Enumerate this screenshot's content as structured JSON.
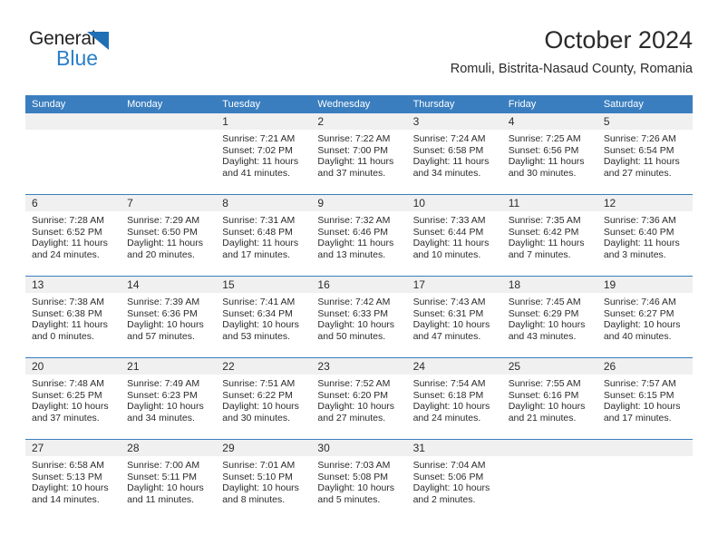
{
  "logo": {
    "word1": "General",
    "word2": "Blue",
    "triangle_color": "#1f6fb5",
    "word2_color": "#2a7fc9"
  },
  "header": {
    "title": "October 2024",
    "subtitle": "Romuli, Bistrita-Nasaud County, Romania"
  },
  "calendar": {
    "header_color": "#3a7ebf",
    "weekdays": [
      "Sunday",
      "Monday",
      "Tuesday",
      "Wednesday",
      "Thursday",
      "Friday",
      "Saturday"
    ],
    "weeks": [
      [
        {
          "day": "",
          "sunrise": "",
          "sunset": "",
          "daylight_line1": "",
          "daylight_line2": "",
          "empty": true
        },
        {
          "day": "",
          "sunrise": "",
          "sunset": "",
          "daylight_line1": "",
          "daylight_line2": "",
          "empty": true
        },
        {
          "day": "1",
          "sunrise": "Sunrise: 7:21 AM",
          "sunset": "Sunset: 7:02 PM",
          "daylight_line1": "Daylight: 11 hours",
          "daylight_line2": "and 41 minutes."
        },
        {
          "day": "2",
          "sunrise": "Sunrise: 7:22 AM",
          "sunset": "Sunset: 7:00 PM",
          "daylight_line1": "Daylight: 11 hours",
          "daylight_line2": "and 37 minutes."
        },
        {
          "day": "3",
          "sunrise": "Sunrise: 7:24 AM",
          "sunset": "Sunset: 6:58 PM",
          "daylight_line1": "Daylight: 11 hours",
          "daylight_line2": "and 34 minutes."
        },
        {
          "day": "4",
          "sunrise": "Sunrise: 7:25 AM",
          "sunset": "Sunset: 6:56 PM",
          "daylight_line1": "Daylight: 11 hours",
          "daylight_line2": "and 30 minutes."
        },
        {
          "day": "5",
          "sunrise": "Sunrise: 7:26 AM",
          "sunset": "Sunset: 6:54 PM",
          "daylight_line1": "Daylight: 11 hours",
          "daylight_line2": "and 27 minutes."
        }
      ],
      [
        {
          "day": "6",
          "sunrise": "Sunrise: 7:28 AM",
          "sunset": "Sunset: 6:52 PM",
          "daylight_line1": "Daylight: 11 hours",
          "daylight_line2": "and 24 minutes."
        },
        {
          "day": "7",
          "sunrise": "Sunrise: 7:29 AM",
          "sunset": "Sunset: 6:50 PM",
          "daylight_line1": "Daylight: 11 hours",
          "daylight_line2": "and 20 minutes."
        },
        {
          "day": "8",
          "sunrise": "Sunrise: 7:31 AM",
          "sunset": "Sunset: 6:48 PM",
          "daylight_line1": "Daylight: 11 hours",
          "daylight_line2": "and 17 minutes."
        },
        {
          "day": "9",
          "sunrise": "Sunrise: 7:32 AM",
          "sunset": "Sunset: 6:46 PM",
          "daylight_line1": "Daylight: 11 hours",
          "daylight_line2": "and 13 minutes."
        },
        {
          "day": "10",
          "sunrise": "Sunrise: 7:33 AM",
          "sunset": "Sunset: 6:44 PM",
          "daylight_line1": "Daylight: 11 hours",
          "daylight_line2": "and 10 minutes."
        },
        {
          "day": "11",
          "sunrise": "Sunrise: 7:35 AM",
          "sunset": "Sunset: 6:42 PM",
          "daylight_line1": "Daylight: 11 hours",
          "daylight_line2": "and 7 minutes."
        },
        {
          "day": "12",
          "sunrise": "Sunrise: 7:36 AM",
          "sunset": "Sunset: 6:40 PM",
          "daylight_line1": "Daylight: 11 hours",
          "daylight_line2": "and 3 minutes."
        }
      ],
      [
        {
          "day": "13",
          "sunrise": "Sunrise: 7:38 AM",
          "sunset": "Sunset: 6:38 PM",
          "daylight_line1": "Daylight: 11 hours",
          "daylight_line2": "and 0 minutes."
        },
        {
          "day": "14",
          "sunrise": "Sunrise: 7:39 AM",
          "sunset": "Sunset: 6:36 PM",
          "daylight_line1": "Daylight: 10 hours",
          "daylight_line2": "and 57 minutes."
        },
        {
          "day": "15",
          "sunrise": "Sunrise: 7:41 AM",
          "sunset": "Sunset: 6:34 PM",
          "daylight_line1": "Daylight: 10 hours",
          "daylight_line2": "and 53 minutes."
        },
        {
          "day": "16",
          "sunrise": "Sunrise: 7:42 AM",
          "sunset": "Sunset: 6:33 PM",
          "daylight_line1": "Daylight: 10 hours",
          "daylight_line2": "and 50 minutes."
        },
        {
          "day": "17",
          "sunrise": "Sunrise: 7:43 AM",
          "sunset": "Sunset: 6:31 PM",
          "daylight_line1": "Daylight: 10 hours",
          "daylight_line2": "and 47 minutes."
        },
        {
          "day": "18",
          "sunrise": "Sunrise: 7:45 AM",
          "sunset": "Sunset: 6:29 PM",
          "daylight_line1": "Daylight: 10 hours",
          "daylight_line2": "and 43 minutes."
        },
        {
          "day": "19",
          "sunrise": "Sunrise: 7:46 AM",
          "sunset": "Sunset: 6:27 PM",
          "daylight_line1": "Daylight: 10 hours",
          "daylight_line2": "and 40 minutes."
        }
      ],
      [
        {
          "day": "20",
          "sunrise": "Sunrise: 7:48 AM",
          "sunset": "Sunset: 6:25 PM",
          "daylight_line1": "Daylight: 10 hours",
          "daylight_line2": "and 37 minutes."
        },
        {
          "day": "21",
          "sunrise": "Sunrise: 7:49 AM",
          "sunset": "Sunset: 6:23 PM",
          "daylight_line1": "Daylight: 10 hours",
          "daylight_line2": "and 34 minutes."
        },
        {
          "day": "22",
          "sunrise": "Sunrise: 7:51 AM",
          "sunset": "Sunset: 6:22 PM",
          "daylight_line1": "Daylight: 10 hours",
          "daylight_line2": "and 30 minutes."
        },
        {
          "day": "23",
          "sunrise": "Sunrise: 7:52 AM",
          "sunset": "Sunset: 6:20 PM",
          "daylight_line1": "Daylight: 10 hours",
          "daylight_line2": "and 27 minutes."
        },
        {
          "day": "24",
          "sunrise": "Sunrise: 7:54 AM",
          "sunset": "Sunset: 6:18 PM",
          "daylight_line1": "Daylight: 10 hours",
          "daylight_line2": "and 24 minutes."
        },
        {
          "day": "25",
          "sunrise": "Sunrise: 7:55 AM",
          "sunset": "Sunset: 6:16 PM",
          "daylight_line1": "Daylight: 10 hours",
          "daylight_line2": "and 21 minutes."
        },
        {
          "day": "26",
          "sunrise": "Sunrise: 7:57 AM",
          "sunset": "Sunset: 6:15 PM",
          "daylight_line1": "Daylight: 10 hours",
          "daylight_line2": "and 17 minutes."
        }
      ],
      [
        {
          "day": "27",
          "sunrise": "Sunrise: 6:58 AM",
          "sunset": "Sunset: 5:13 PM",
          "daylight_line1": "Daylight: 10 hours",
          "daylight_line2": "and 14 minutes."
        },
        {
          "day": "28",
          "sunrise": "Sunrise: 7:00 AM",
          "sunset": "Sunset: 5:11 PM",
          "daylight_line1": "Daylight: 10 hours",
          "daylight_line2": "and 11 minutes."
        },
        {
          "day": "29",
          "sunrise": "Sunrise: 7:01 AM",
          "sunset": "Sunset: 5:10 PM",
          "daylight_line1": "Daylight: 10 hours",
          "daylight_line2": "and 8 minutes."
        },
        {
          "day": "30",
          "sunrise": "Sunrise: 7:03 AM",
          "sunset": "Sunset: 5:08 PM",
          "daylight_line1": "Daylight: 10 hours",
          "daylight_line2": "and 5 minutes."
        },
        {
          "day": "31",
          "sunrise": "Sunrise: 7:04 AM",
          "sunset": "Sunset: 5:06 PM",
          "daylight_line1": "Daylight: 10 hours",
          "daylight_line2": "and 2 minutes."
        },
        {
          "day": "",
          "sunrise": "",
          "sunset": "",
          "daylight_line1": "",
          "daylight_line2": "",
          "empty": true
        },
        {
          "day": "",
          "sunrise": "",
          "sunset": "",
          "daylight_line1": "",
          "daylight_line2": "",
          "empty": true
        }
      ]
    ]
  }
}
